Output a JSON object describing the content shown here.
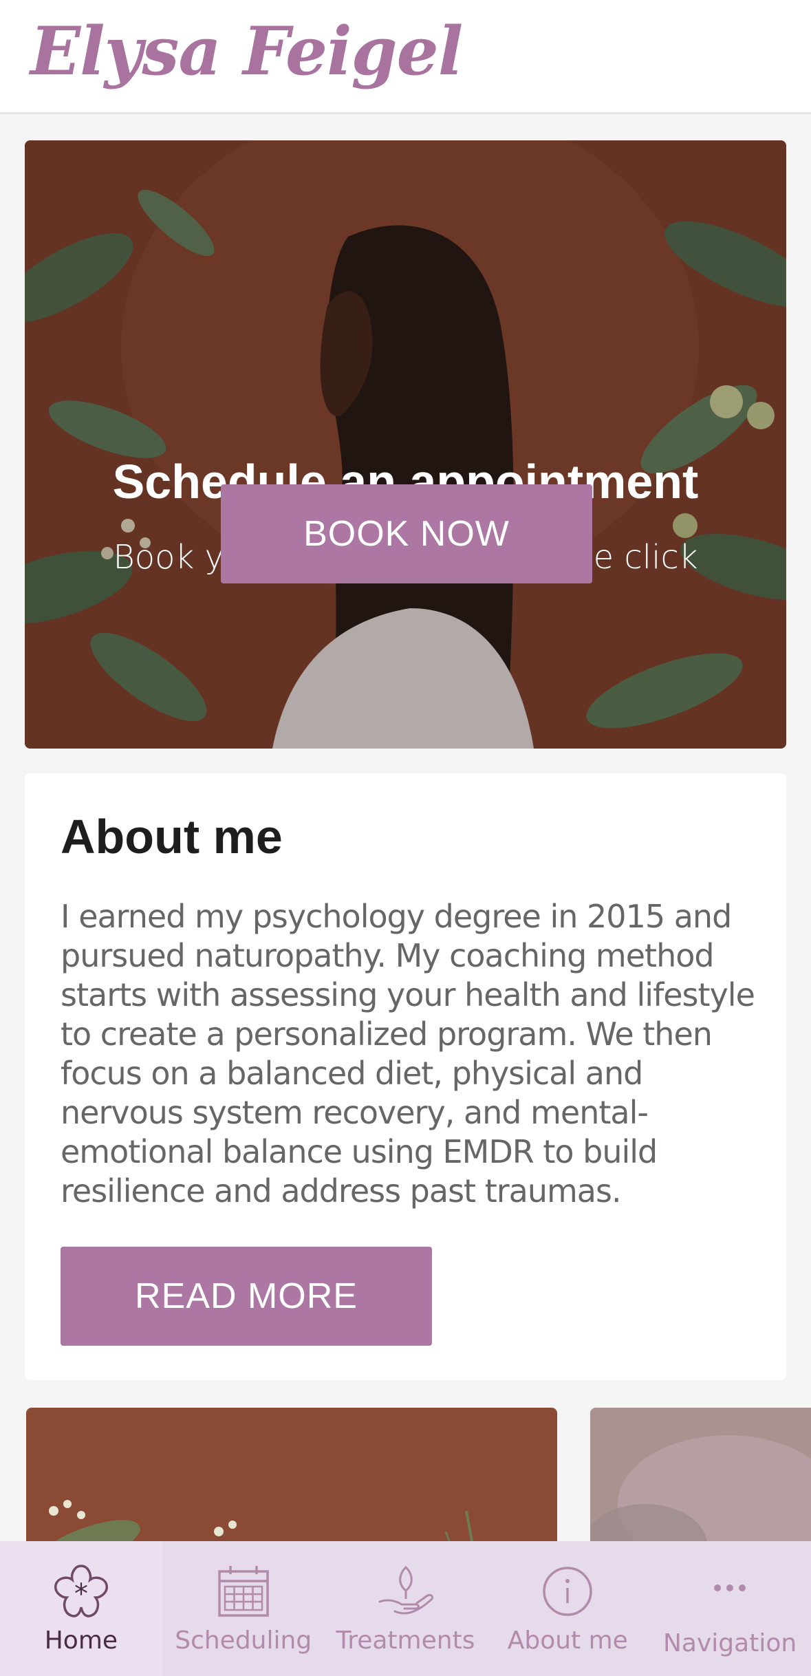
{
  "header": {
    "logo_text": "Elysa Feigel"
  },
  "hero": {
    "title": "Schedule an appointment",
    "subtitle": "Book your appointment in one click",
    "button_label": "BOOK NOW"
  },
  "about": {
    "title": "About me",
    "text": "I earned my psychology degree in 2015 and pursued naturopathy. My coaching method starts with assessing your health and lifestyle to create a personalized program. We then focus on a balanced diet, physical and nervous system recovery, and mental-emotional balance using EMDR to build resilience and address past traumas.",
    "button_label": "READ MORE"
  },
  "tabbar": {
    "items": [
      {
        "label": "Home",
        "icon": "flower-icon",
        "active": true
      },
      {
        "label": "Scheduling",
        "icon": "calendar-icon",
        "active": false
      },
      {
        "label": "Treatments",
        "icon": "hand-plant-icon",
        "active": false
      },
      {
        "label": "About me",
        "icon": "info-icon",
        "active": false
      },
      {
        "label": "Navigation",
        "icon": "more-icon",
        "active": false
      }
    ]
  },
  "colors": {
    "accent": "#ad77a3",
    "logo": "#a9739f",
    "tabbar_bg": "#e6dbeb",
    "tab_label": "#b28aac",
    "tab_active_label": "#4a2d45"
  }
}
